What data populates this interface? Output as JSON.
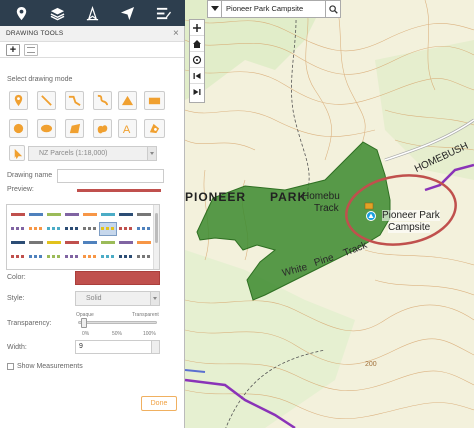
{
  "toolbar": {
    "icons": [
      "map-pin-icon",
      "layers-icon",
      "compass-icon",
      "send-icon",
      "menu-edit-icon"
    ]
  },
  "panel": {
    "title": "DRAWING TOOLS",
    "close_symbol": "×",
    "select_mode_label": "Select drawing mode",
    "parcel_select_value": "NZ Parcels (1:18,000)",
    "drawing_name_label": "Drawing name",
    "drawing_name_value": "",
    "preview_label": "Preview:",
    "color_label": "Color:",
    "color_value": "#c0504d",
    "style_label": "Style:",
    "style_value": "Solid",
    "transparency_label": "Transparency:",
    "transparency_opaque": "Opaque",
    "transparency_transparent": "Transparent",
    "transparency_ticks": [
      "0%",
      "50%",
      "100%"
    ],
    "transparency_value_percent": 0,
    "width_label": "Width:",
    "width_value": "9",
    "show_measurements_label": "Show Measurements",
    "show_measurements_checked": false,
    "done_label": "Done"
  },
  "map": {
    "search_value": "Pioneer Park Campsite",
    "labels": {
      "pioneer": "PIONEER",
      "park": "PARK",
      "homebush_track_1": "Homebu",
      "homebush_track_2": "Track",
      "homebush": "HOMEBUSH",
      "pioneer_park_campsite_1": "Pioneer Park",
      "pioneer_park_campsite_2": "Campsite",
      "white": "White",
      "pine": "Pine",
      "track": "Track",
      "contour_200": "200"
    },
    "controls": [
      "zoom-in",
      "home",
      "locate",
      "back",
      "forward"
    ]
  }
}
